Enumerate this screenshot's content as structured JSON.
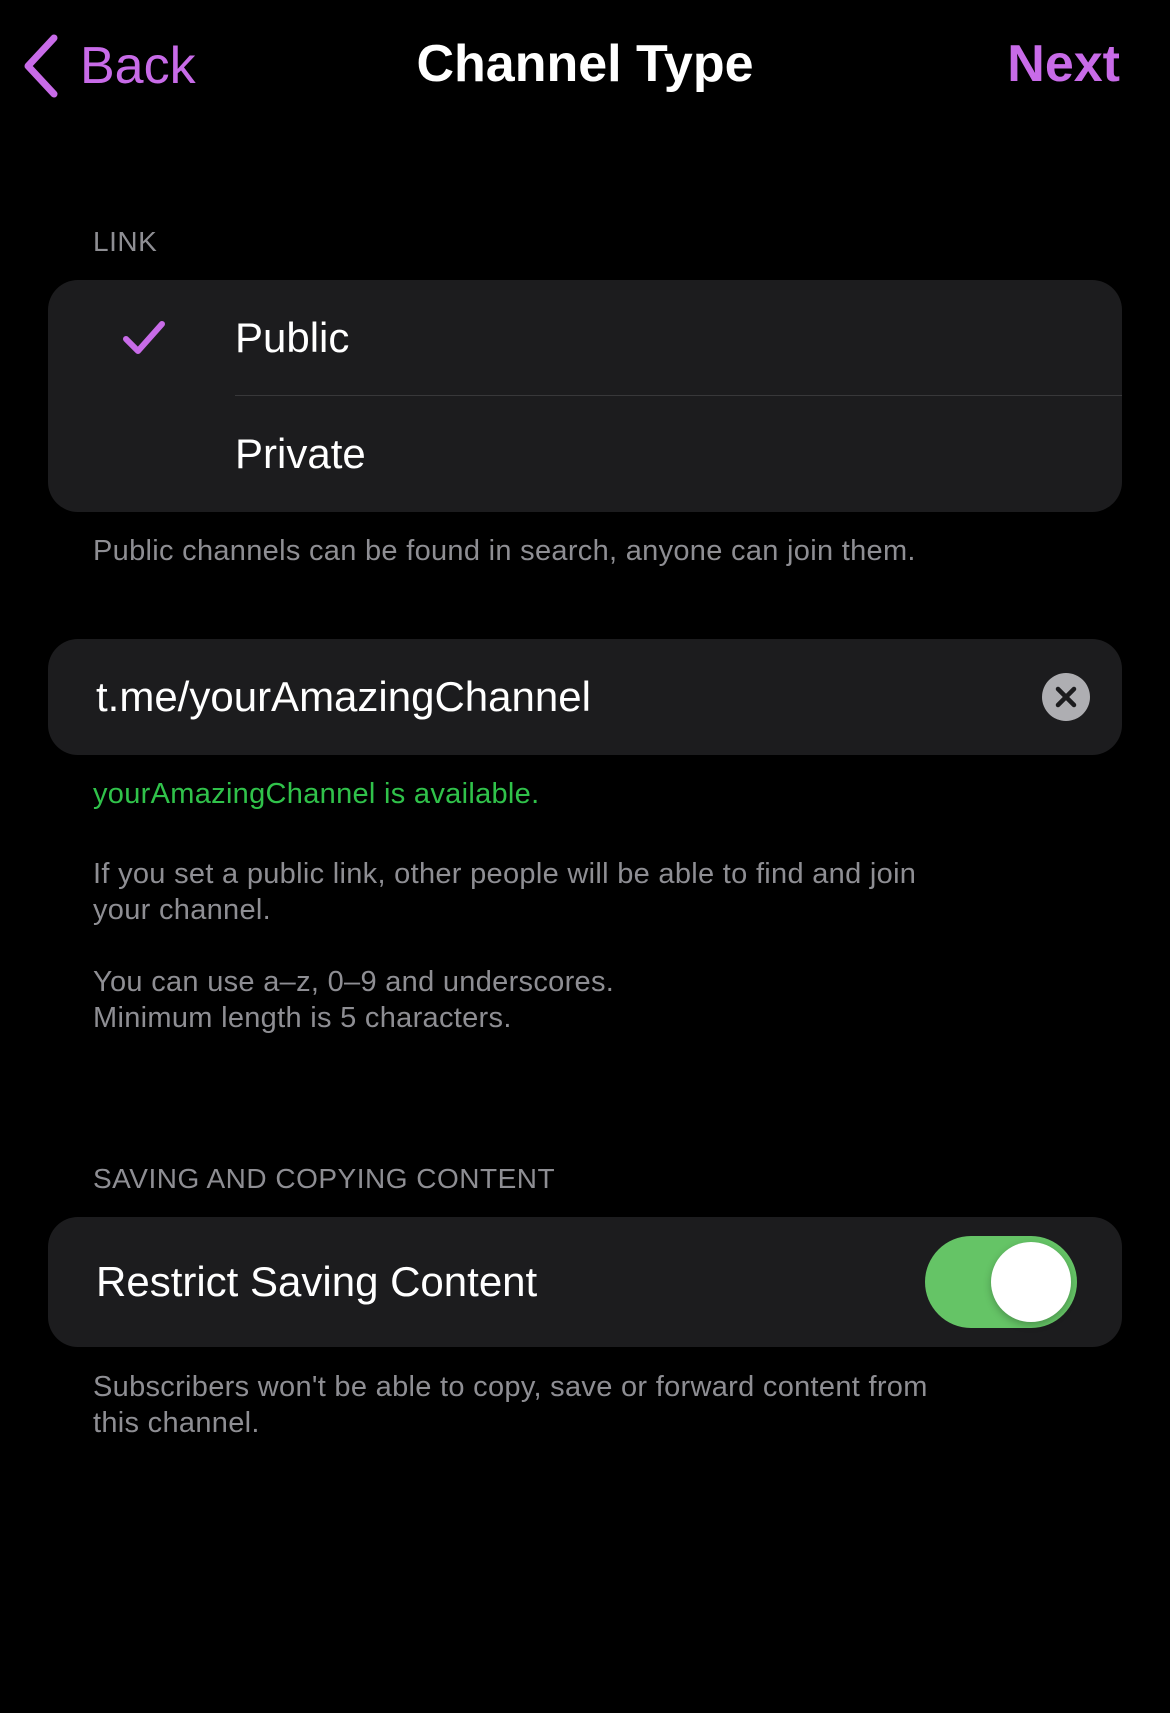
{
  "nav": {
    "back_label": "Back",
    "title": "Channel Type",
    "next_label": "Next"
  },
  "link_section": {
    "header": "LINK",
    "options": [
      {
        "label": "Public",
        "selected": true
      },
      {
        "label": "Private",
        "selected": false
      }
    ],
    "footer": "Public channels can be found in search, anyone can join them."
  },
  "username_section": {
    "value": "t.me/yourAmazingChannel",
    "status": "yourAmazingChannel is available.",
    "info": "If you set a public link, other people will be able to find and join\nyour channel.",
    "rules": "You can use a–z, 0–9 and underscores.\nMinimum length is 5 characters."
  },
  "content_section": {
    "header": "SAVING AND COPYING CONTENT",
    "toggle_label": "Restrict Saving Content",
    "toggle_on": true,
    "footer": "Subscribers won't be able to copy, save or forward content from\nthis channel."
  },
  "colors": {
    "accent": "#c86be8",
    "success": "#30c24a",
    "toggle_on": "#65c466",
    "cell_background": "#1c1c1e",
    "secondary_text": "#8e8e93"
  },
  "icons": {
    "back": "chevron-left-icon",
    "check": "checkmark-icon",
    "clear": "clear-x-circle-icon"
  }
}
